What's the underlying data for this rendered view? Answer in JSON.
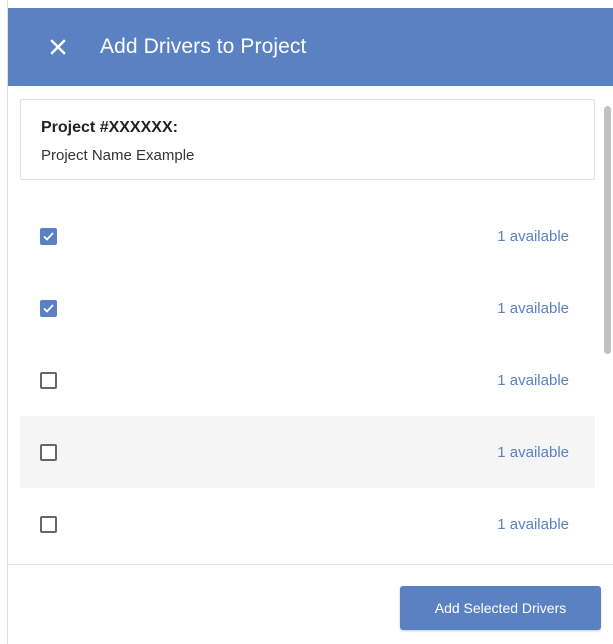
{
  "colors": {
    "accent": "#5a82c2",
    "header_bg": "#5a82c2",
    "link": "#5a82c2",
    "row_shade": "#f5f5f5"
  },
  "header": {
    "close_icon": "close-icon",
    "title": "Add Drivers to Project"
  },
  "project": {
    "label": "Project #XXXXXX:",
    "name": "Project Name Example"
  },
  "drivers": [
    {
      "checked": true,
      "availability": "1 available"
    },
    {
      "checked": true,
      "availability": "1 available"
    },
    {
      "checked": false,
      "availability": "1 available"
    },
    {
      "checked": false,
      "availability": "1 available"
    },
    {
      "checked": false,
      "availability": "1 available"
    }
  ],
  "footer": {
    "add_button_label": "Add Selected Drivers"
  }
}
